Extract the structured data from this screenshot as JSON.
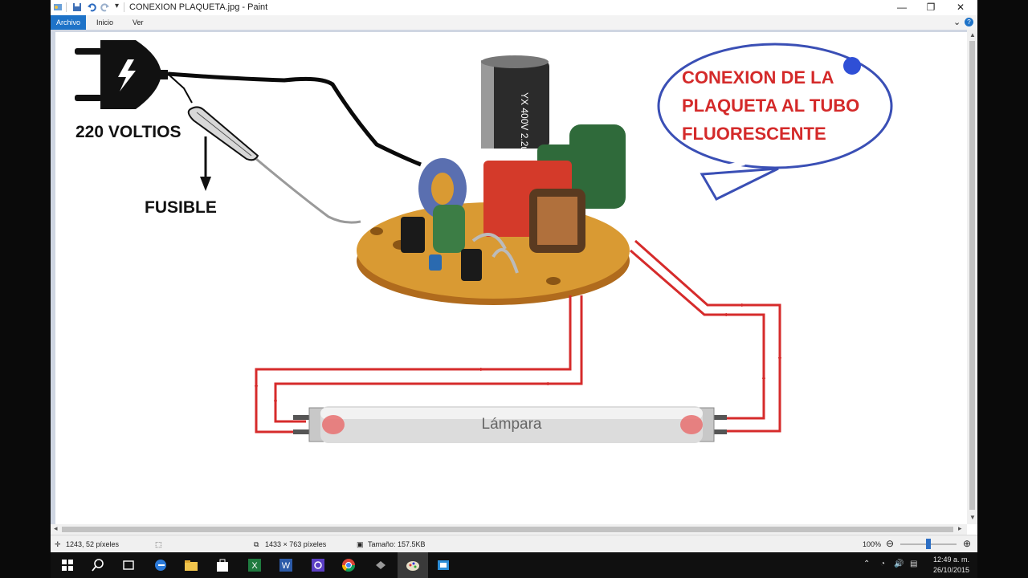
{
  "window": {
    "title": "CONEXION PLAQUETA.jpg - Paint",
    "minimize": "—",
    "maximize": "❐",
    "close": "✕"
  },
  "ribbon": {
    "tabs": [
      {
        "label": "Archivo"
      },
      {
        "label": "Inicio"
      },
      {
        "label": "Ver"
      }
    ],
    "collapse": "⌄",
    "help": "?"
  },
  "image": {
    "plug_label": "220 VOLTIOS",
    "fuse_label": "FUSIBLE",
    "bubble_lines": [
      "CONEXION DE LA",
      "PLAQUETA AL TUBO",
      "FLUORESCENTE"
    ],
    "lamp_label": "Lámpara",
    "capacitor_text": "YX 400V 2.2uF",
    "colors": {
      "bubble_text": "#d42a2a",
      "bubble_border": "#3a4fb5",
      "wire_red": "#d62b2b",
      "board": "#d99a33"
    }
  },
  "statusbar": {
    "cursor": "1243, 52 píxeles",
    "dimensions": "1433 × 763 píxeles",
    "size": "Tamaño: 157.5KB",
    "zoom": "100%"
  },
  "taskbar": {
    "time": "12:49 a. m.",
    "date": "26/10/2015"
  }
}
